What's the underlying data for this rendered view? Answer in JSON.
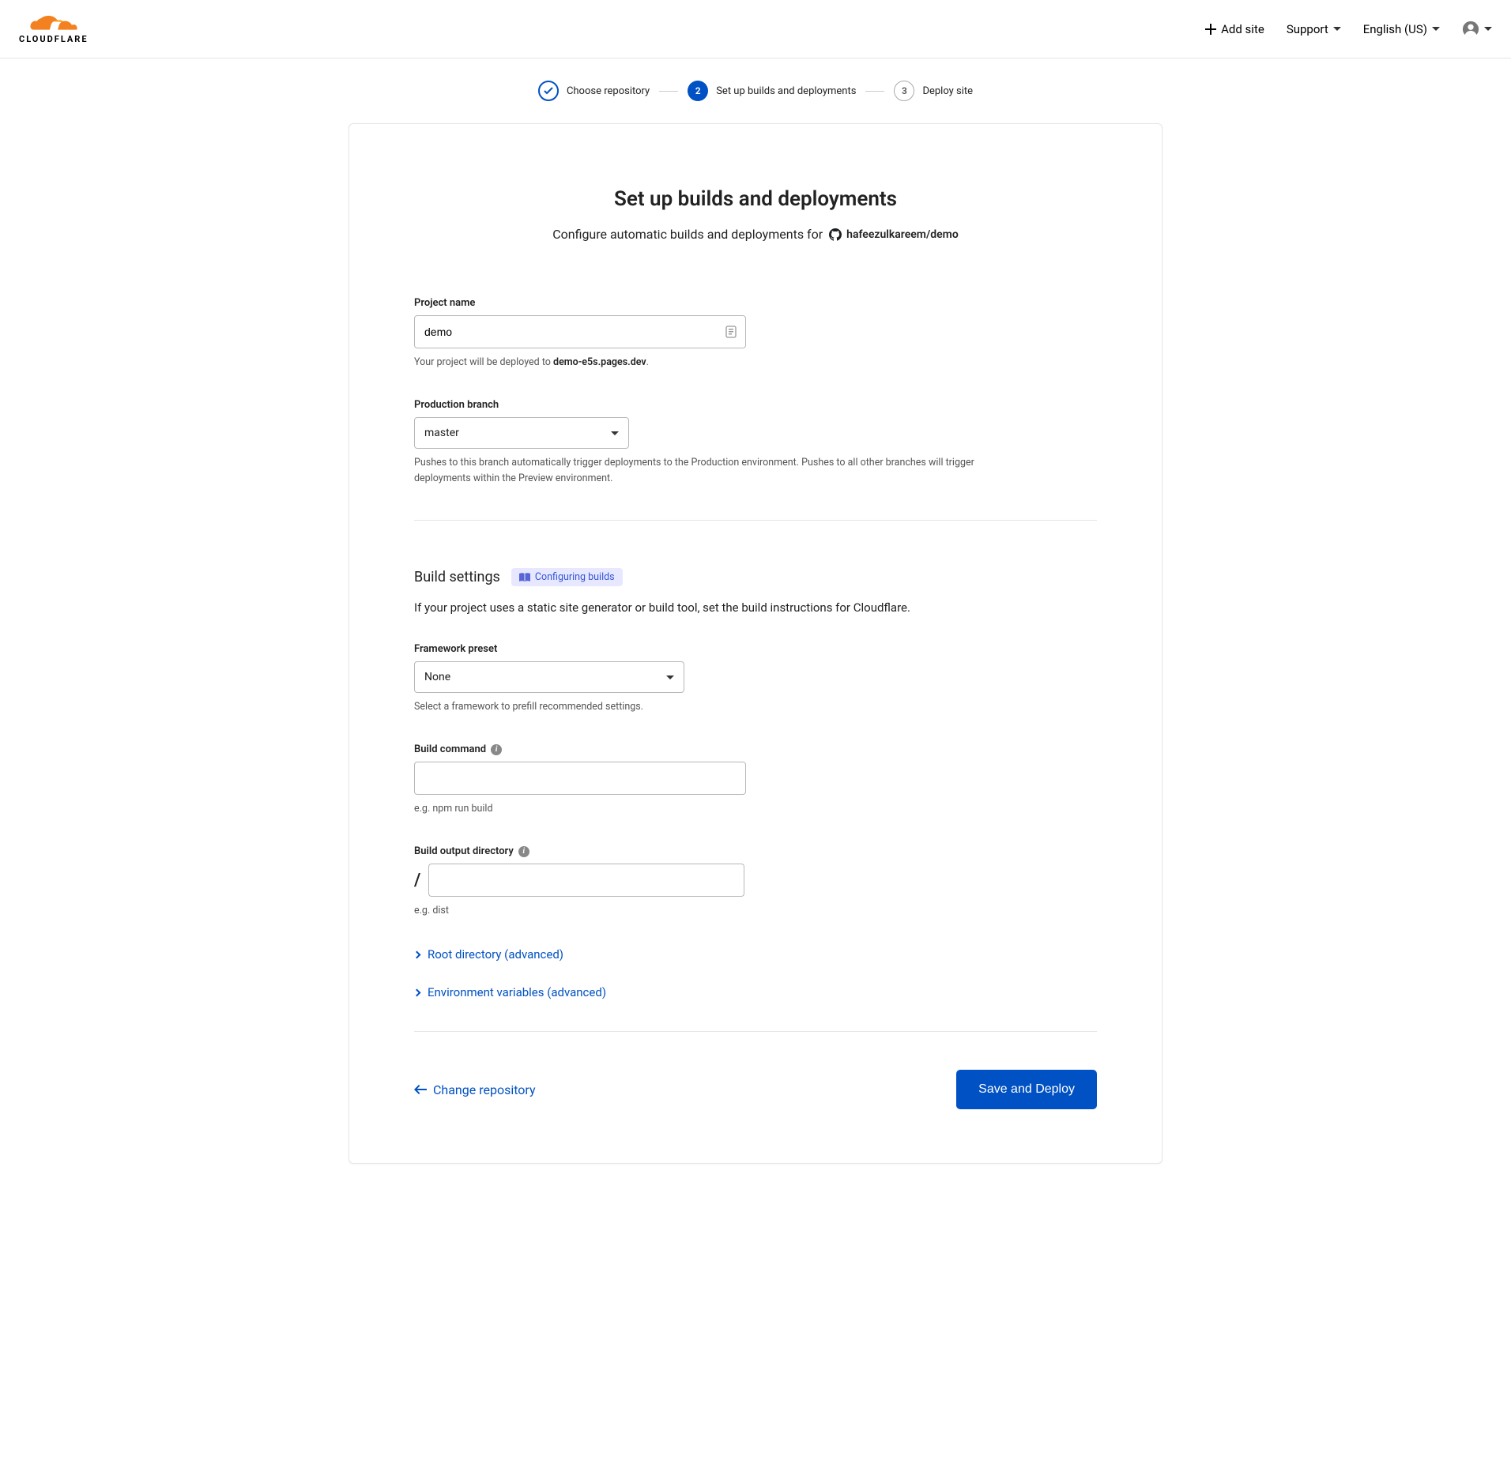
{
  "header": {
    "add_site": "Add site",
    "support": "Support",
    "language": "English (US)"
  },
  "stepper": {
    "step1": "Choose repository",
    "step2_num": "2",
    "step2": "Set up builds and deployments",
    "step3_num": "3",
    "step3": "Deploy site"
  },
  "page": {
    "title": "Set up builds and deployments",
    "subtitle_prefix": "Configure automatic builds and deployments for",
    "repo": "hafeezulkareem/demo"
  },
  "project_name": {
    "label": "Project name",
    "value": "demo",
    "help_prefix": "Your project will be deployed to ",
    "help_domain": "demo-e5s.pages.dev",
    "help_suffix": "."
  },
  "branch": {
    "label": "Production branch",
    "value": "master",
    "help": "Pushes to this branch automatically trigger deployments to the Production environment. Pushes to all other branches will trigger deployments within the Preview environment."
  },
  "build": {
    "section_title": "Build settings",
    "badge": "Configuring builds",
    "description": "If your project uses a static site generator or build tool, set the build instructions for Cloudflare."
  },
  "framework": {
    "label": "Framework preset",
    "value": "None",
    "help": "Select a framework to prefill recommended settings."
  },
  "build_command": {
    "label": "Build command",
    "help": "e.g. npm run build"
  },
  "output_dir": {
    "label": "Build output directory",
    "prefix": "/",
    "help": "e.g. dist"
  },
  "advanced": {
    "root_dir": "Root directory (advanced)",
    "env_vars": "Environment variables (advanced)"
  },
  "footer": {
    "back": "Change repository",
    "submit": "Save and Deploy"
  }
}
